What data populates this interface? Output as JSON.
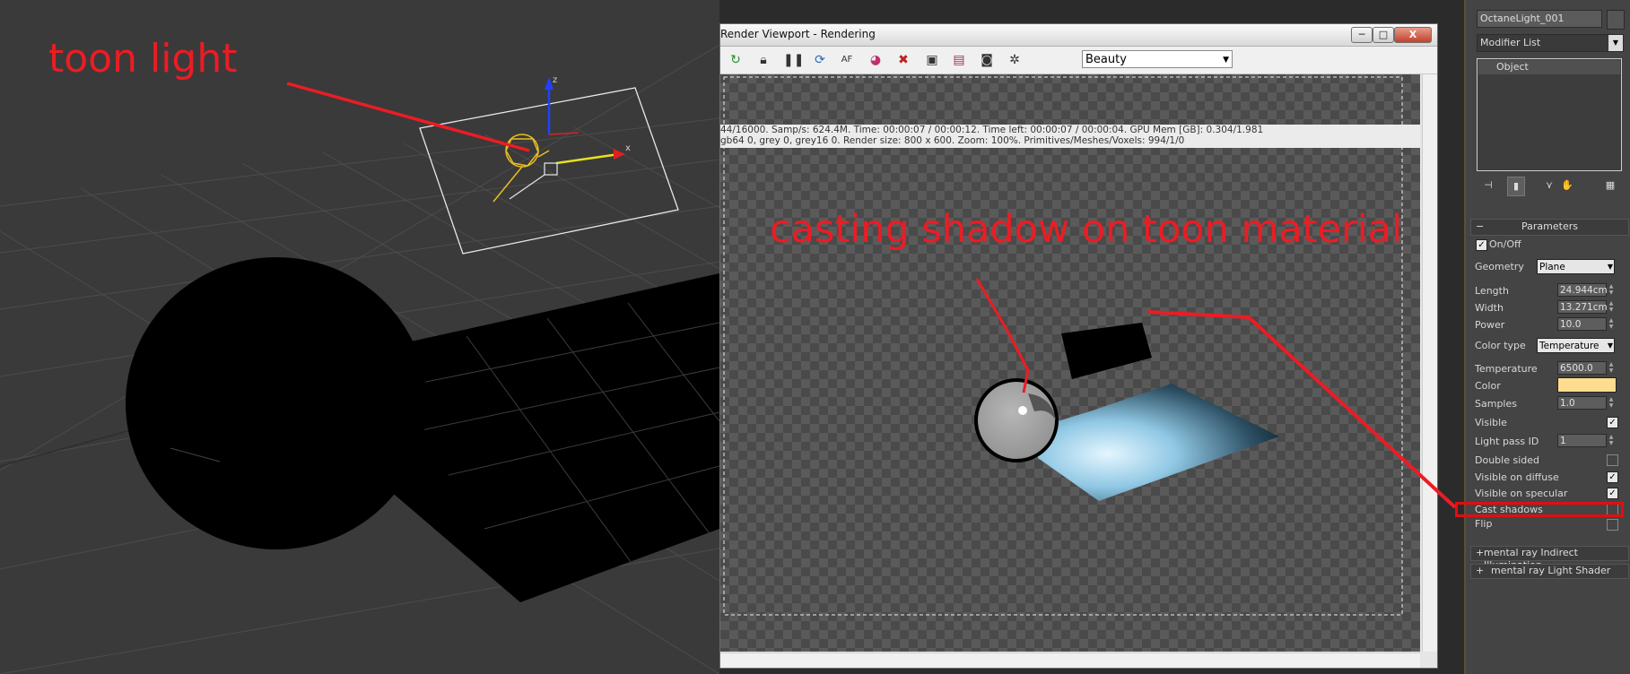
{
  "annotations": {
    "toon_light": "toon light",
    "casting_shadow": "casting shadow on toon material"
  },
  "viewport_left": {
    "gizmo_labels": {
      "z": "z",
      "x": "x"
    }
  },
  "render_window": {
    "title": "Render Viewport - Rendering",
    "buttons": {
      "minimize": "─",
      "maximize": "□",
      "close": "X"
    },
    "toolbar": {
      "icons": [
        "refresh-icon",
        "lock-icon",
        "pause-icon",
        "restart-icon",
        "focus-pick-icon",
        "color-picker-icon",
        "clear-icon",
        "screen-icon",
        "save-icon",
        "camera-icon",
        "settings-icon"
      ],
      "render_pass": "Beauty"
    },
    "stats": {
      "line1": "44/16000.   Samp/s: 624.4M.   Time: 00:00:07 / 00:00:12.   Time left: 00:00:07 / 00:00:04.   GPU Mem [GB]: 0.304/1.981",
      "line2": "gb64 0, grey 0, grey16 0.   Render size: 800 x 600.   Zoom: 100%.   Primitives/Meshes/Voxels: 994/1/0"
    }
  },
  "command_panel": {
    "object_name": "OctaneLight_001",
    "modifier_list": "Modifier List",
    "stack_item": "Object",
    "rollout_title": "Parameters",
    "rollout_collapse": "−",
    "params": {
      "on_off": {
        "label": "On/Off",
        "checked": true
      },
      "geometry": {
        "label": "Geometry",
        "value": "Plane"
      },
      "length": {
        "label": "Length",
        "value": "24.944cm"
      },
      "width": {
        "label": "Width",
        "value": "13.271cm"
      },
      "power": {
        "label": "Power",
        "value": "10.0"
      },
      "color_type": {
        "label": "Color type",
        "value": "Temperature"
      },
      "temperature": {
        "label": "Temperature",
        "value": "6500.0"
      },
      "color": {
        "label": "Color",
        "swatch": "#fedd8f"
      },
      "samples": {
        "label": "Samples",
        "value": "1.0"
      },
      "visible": {
        "label": "Visible",
        "checked": true
      },
      "light_pass_id": {
        "label": "Light pass ID",
        "value": "1"
      },
      "double_sided": {
        "label": "Double sided",
        "checked": false
      },
      "visible_on_diffuse": {
        "label": "Visible on diffuse",
        "checked": true
      },
      "visible_on_specular": {
        "label": "Visible on specular",
        "checked": true
      },
      "cast_shadows": {
        "label": "Cast shadows",
        "checked": false
      },
      "flip": {
        "label": "Flip",
        "checked": false
      }
    },
    "rollouts": [
      "mental ray Indirect Illumination",
      "mental ray Light Shader"
    ],
    "rollout_expand": "+"
  },
  "colors": {
    "annotation_red": "#ec1c24",
    "viewport_bg": "#3a3a3a",
    "light_gizmo": "#e8c020"
  }
}
